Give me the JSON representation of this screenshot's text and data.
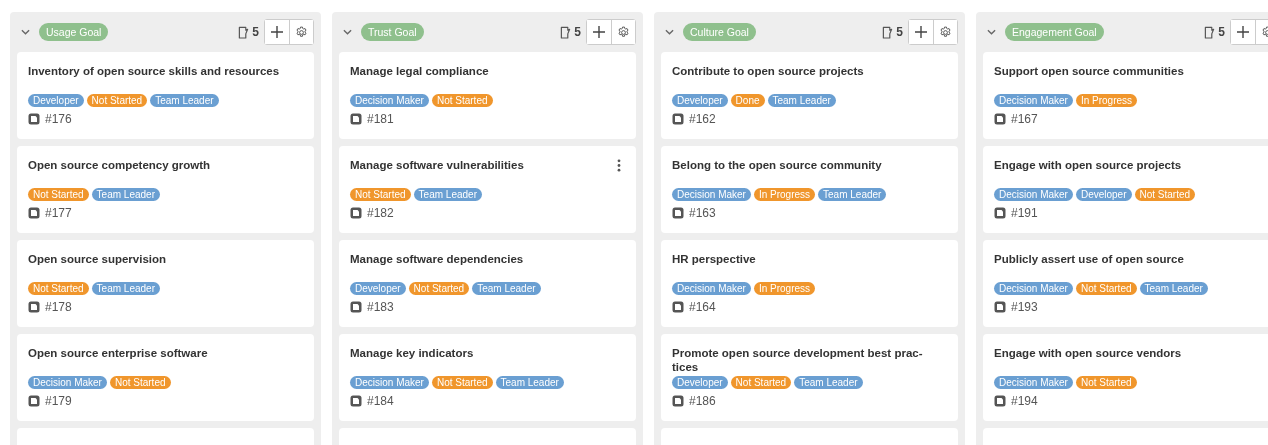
{
  "columns": [
    {
      "title": "Usage Goal",
      "expanded": true,
      "count": "5",
      "cards": [
        {
          "title": "Inventory of open source skills and resources",
          "tags": [
            {
              "label": "Developer",
              "color": "#6a9fd2"
            },
            {
              "label": "Not Started",
              "color": "#f0962c"
            },
            {
              "label": "Team Leader",
              "color": "#6a9fd2"
            }
          ],
          "ref": "#176",
          "menu": false
        },
        {
          "title": "Open source competency growth",
          "tags": [
            {
              "label": "Not Started",
              "color": "#f0962c"
            },
            {
              "label": "Team Leader",
              "color": "#6a9fd2"
            }
          ],
          "ref": "#177",
          "menu": false
        },
        {
          "title": "Open source supervision",
          "tags": [
            {
              "label": "Not Started",
              "color": "#f0962c"
            },
            {
              "label": "Team Leader",
              "color": "#6a9fd2"
            }
          ],
          "ref": "#178",
          "menu": false
        },
        {
          "title": "Open source enterprise software",
          "tags": [
            {
              "label": "Decision Maker",
              "color": "#6a9fd2"
            },
            {
              "label": "Not Started",
              "color": "#f0962c"
            }
          ],
          "ref": "#179",
          "menu": false
        },
        {
          "menu": false
        }
      ]
    },
    {
      "title": "Trust Goal",
      "expanded": true,
      "count": "5",
      "cards": [
        {
          "title": "Manage legal compliance",
          "tags": [
            {
              "label": "Decision Maker",
              "color": "#6a9fd2"
            },
            {
              "label": "Not Started",
              "color": "#f0962c"
            }
          ],
          "ref": "#181",
          "menu": false
        },
        {
          "title": "Manage software vulnerabilities",
          "tags": [
            {
              "label": "Not Started",
              "color": "#f0962c"
            },
            {
              "label": "Team Leader",
              "color": "#6a9fd2"
            }
          ],
          "ref": "#182",
          "menu": true
        },
        {
          "title": "Manage software dependencies",
          "tags": [
            {
              "label": "Developer",
              "color": "#6a9fd2"
            },
            {
              "label": "Not Started",
              "color": "#f0962c"
            },
            {
              "label": "Team Leader",
              "color": "#6a9fd2"
            }
          ],
          "ref": "#183",
          "menu": false
        },
        {
          "title": "Manage key indicators",
          "tags": [
            {
              "label": "Decision Maker",
              "color": "#6a9fd2"
            },
            {
              "label": "Not Started",
              "color": "#f0962c"
            },
            {
              "label": "Team Leader",
              "color": "#6a9fd2"
            }
          ],
          "ref": "#184",
          "menu": false
        },
        {
          "menu": false
        }
      ]
    },
    {
      "title": "Culture Goal",
      "expanded": true,
      "count": "5",
      "cards": [
        {
          "title": "Contribute to open source projects",
          "tags": [
            {
              "label": "Developer",
              "color": "#6a9fd2"
            },
            {
              "label": "Done",
              "color": "#f0962c"
            },
            {
              "label": "Team Leader",
              "color": "#6a9fd2"
            }
          ],
          "ref": "#162",
          "menu": false
        },
        {
          "title": "Belong to the open source community",
          "tags": [
            {
              "label": "Decision Maker",
              "color": "#6a9fd2"
            },
            {
              "label": "In Progress",
              "color": "#f0962c"
            },
            {
              "label": "Team Leader",
              "color": "#6a9fd2"
            }
          ],
          "ref": "#163",
          "menu": false
        },
        {
          "title": "HR perspective",
          "tags": [
            {
              "label": "Decision Maker",
              "color": "#6a9fd2"
            },
            {
              "label": "In Progress",
              "color": "#f0962c"
            }
          ],
          "ref": "#164",
          "menu": false
        },
        {
          "title": "Promote open source development best prac-\ntices",
          "tags": [
            {
              "label": "Developer",
              "color": "#6a9fd2"
            },
            {
              "label": "Not Started",
              "color": "#f0962c"
            },
            {
              "label": "Team Leader",
              "color": "#6a9fd2"
            }
          ],
          "ref": "#186",
          "menu": false
        },
        {
          "menu": false
        }
      ]
    },
    {
      "title": "Engagement Goal",
      "expanded": true,
      "count": "5",
      "cards": [
        {
          "title": "Support open source communities",
          "tags": [
            {
              "label": "Decision Maker",
              "color": "#6a9fd2"
            },
            {
              "label": "In Progress",
              "color": "#f0962c"
            }
          ],
          "ref": "#167",
          "menu": false
        },
        {
          "title": "Engage with open source projects",
          "tags": [
            {
              "label": "Decision Maker",
              "color": "#6a9fd2"
            },
            {
              "label": "Developer",
              "color": "#6a9fd2"
            },
            {
              "label": "Not Started",
              "color": "#f0962c"
            }
          ],
          "ref": "#191",
          "menu": false
        },
        {
          "title": "Publicly assert use of open source",
          "tags": [
            {
              "label": "Decision Maker",
              "color": "#6a9fd2"
            },
            {
              "label": "Not Started",
              "color": "#f0962c"
            },
            {
              "label": "Team Leader",
              "color": "#6a9fd2"
            }
          ],
          "ref": "#193",
          "menu": false
        },
        {
          "title": "Engage with open source vendors",
          "tags": [
            {
              "label": "Decision Maker",
              "color": "#6a9fd2"
            },
            {
              "label": "Not Started",
              "color": "#f0962c"
            }
          ],
          "ref": "#194",
          "menu": false
        },
        {
          "menu": false
        }
      ]
    }
  ]
}
